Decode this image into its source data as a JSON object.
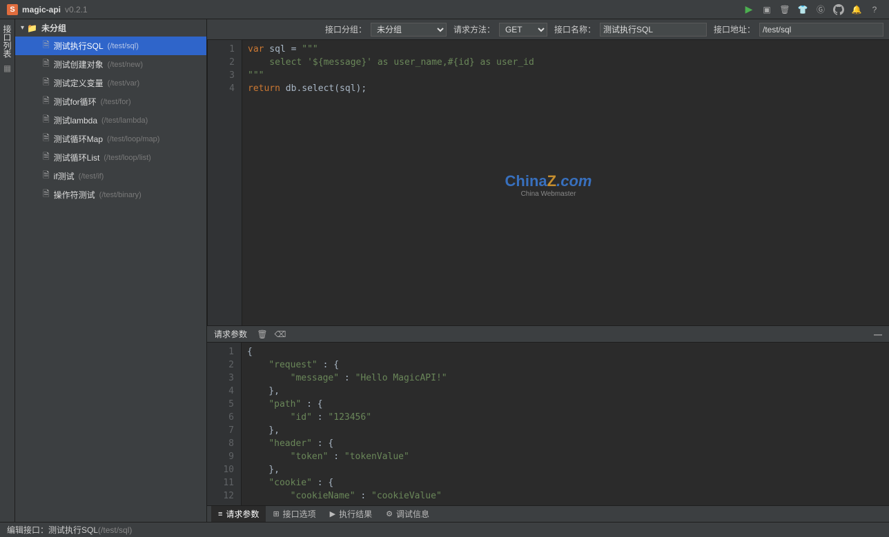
{
  "app": {
    "title": "magic-api",
    "version": "v0.2.1"
  },
  "titlebar_icons": [
    "run",
    "save",
    "delete",
    "tools",
    "git",
    "github",
    "bell",
    "help"
  ],
  "left_rail": {
    "label": "接口列表"
  },
  "sidebar": {
    "group_name": "未分组",
    "items": [
      {
        "label": "测试执行SQL",
        "path": "(/test/sql)",
        "active": true
      },
      {
        "label": "测试创建对象",
        "path": "(/test/new)"
      },
      {
        "label": "测试定义变量",
        "path": "(/test/var)"
      },
      {
        "label": "测试for循环",
        "path": "(/test/for)"
      },
      {
        "label": "测试lambda",
        "path": "(/test/lambda)"
      },
      {
        "label": "测试循环Map",
        "path": "(/test/loop/map)"
      },
      {
        "label": "测试循环List",
        "path": "(/test/loop/list)"
      },
      {
        "label": "if测试",
        "path": "(/test/if)"
      },
      {
        "label": "操作符测试",
        "path": "(/test/binary)"
      }
    ]
  },
  "toolbar": {
    "group_label": "接口分组：",
    "group_value": "未分组",
    "method_label": "请求方法：",
    "method_value": "GET",
    "name_label": "接口名称：",
    "name_value": "测试执行SQL",
    "path_label": "接口地址：",
    "path_value": "/test/sql"
  },
  "editor": {
    "line_count": 4,
    "lines": [
      [
        {
          "t": "var",
          "c": "kw"
        },
        {
          "t": " sql = ",
          "c": "punc"
        },
        {
          "t": "\"\"\"",
          "c": "str"
        }
      ],
      [
        {
          "t": "    select '${message}' as user_name,#{id} as user_id",
          "c": "str"
        }
      ],
      [
        {
          "t": "\"\"\"",
          "c": "str"
        }
      ],
      [
        {
          "t": "return",
          "c": "kw"
        },
        {
          "t": " db.select(sql);",
          "c": "punc"
        }
      ]
    ]
  },
  "watermark": {
    "brand_1": "China",
    "brand_2": "Z",
    "brand_3": ".com",
    "sub": "China Webmaster"
  },
  "bottom": {
    "header_title": "请求参数",
    "line_count": 12,
    "json_lines": [
      "{",
      "    \"request\" : {",
      "        \"message\" : \"Hello MagicAPI!\"",
      "    },",
      "    \"path\" : {",
      "        \"id\" : \"123456\"",
      "    },",
      "    \"header\" : {",
      "        \"token\" : \"tokenValue\"",
      "    },",
      "    \"cookie\" : {",
      "        \"cookieName\" : \"cookieValue\""
    ],
    "tabs": [
      {
        "label": "请求参数",
        "icon": "≡",
        "active": true
      },
      {
        "label": "接口选项",
        "icon": "⊞"
      },
      {
        "label": "执行结果",
        "icon": "▶"
      },
      {
        "label": "调试信息",
        "icon": "⚙"
      }
    ]
  },
  "status": {
    "prefix": "编辑接口：",
    "name": "测试执行SQL",
    "path": "(/test/sql)"
  }
}
